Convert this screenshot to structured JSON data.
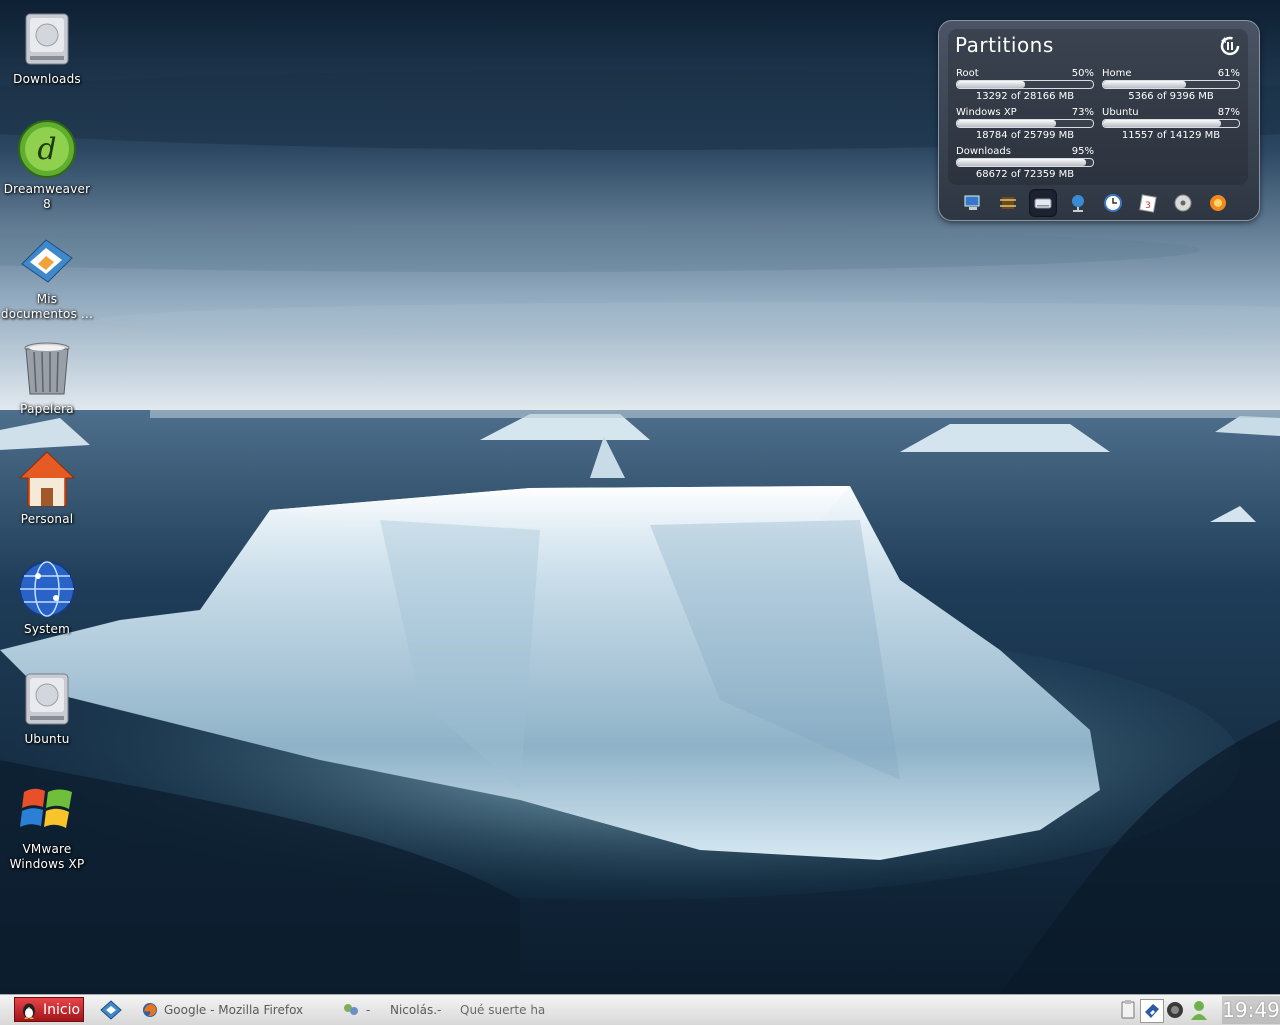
{
  "desktop": {
    "icons": [
      {
        "label": "Downloads",
        "icon": "hard-drive-icon"
      },
      {
        "label": "Dreamweaver\n8",
        "icon": "dreamweaver-icon"
      },
      {
        "label": "Mis\ndocumentos ...",
        "icon": "documents-folder-icon"
      },
      {
        "label": "Papelera",
        "icon": "trash-icon"
      },
      {
        "label": "Personal",
        "icon": "home-icon"
      },
      {
        "label": "System",
        "icon": "globe-icon"
      },
      {
        "label": "Ubuntu",
        "icon": "hard-drive-icon"
      },
      {
        "label": "VMware\nWindows XP",
        "icon": "windows-logo-icon"
      }
    ]
  },
  "widget": {
    "title": "Partitions",
    "partitions": [
      {
        "name": "Root",
        "percent": "50%",
        "sizes": "13292 of 28166 MB",
        "fill": 0.5
      },
      {
        "name": "Home",
        "percent": "61%",
        "sizes": "5366 of 9396 MB",
        "fill": 0.61
      },
      {
        "name": "Windows XP",
        "percent": "73%",
        "sizes": "18784 of 25799 MB",
        "fill": 0.73
      },
      {
        "name": "Ubuntu",
        "percent": "87%",
        "sizes": "11557 of 14129 MB",
        "fill": 0.87
      },
      {
        "name": "Downloads",
        "percent": "95%",
        "sizes": "68672 of 72359 MB",
        "fill": 0.95
      }
    ],
    "dock": [
      "computer-icon",
      "chip-icon",
      "drive-icon",
      "network-icon",
      "clock-icon",
      "calendar-icon",
      "disc-icon",
      "weather-icon"
    ],
    "active_dock_index": 2
  },
  "taskbar": {
    "start_label": "Inicio",
    "tasks": [
      {
        "label": "Google - Mozilla Firefox",
        "icon": "firefox-icon"
      },
      {
        "label": "-",
        "icon": "chat-icon"
      },
      {
        "label": "Nicolás.-",
        "icon": ""
      },
      {
        "label": "Qué suerte ha",
        "icon": ""
      }
    ],
    "clock": "19:49"
  },
  "colors": {
    "start_button": "#c8262b",
    "widget_bg": "#3b4350",
    "sky_top": "#0f2236",
    "ocean": "#1c3650"
  }
}
